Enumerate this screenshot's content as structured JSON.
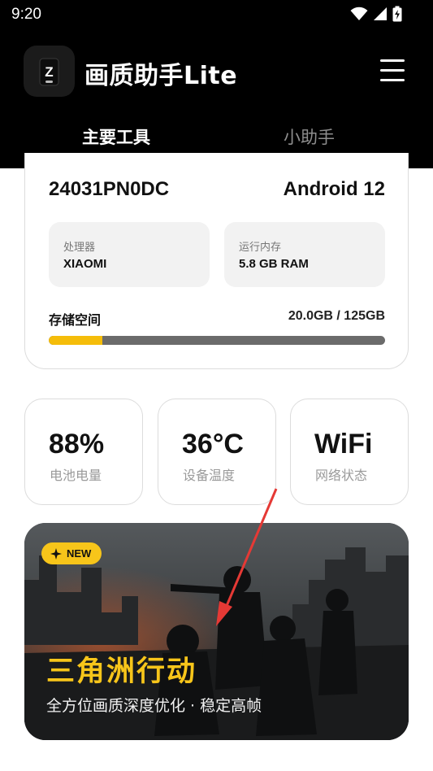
{
  "status_bar": {
    "time": "9:20",
    "icons": [
      "wifi-icon",
      "signal-icon",
      "battery-charging-icon"
    ]
  },
  "app": {
    "title": "画质助手Lite",
    "icon_letter": "Z",
    "menu_icon": "hamburger-menu-icon"
  },
  "tabs": [
    {
      "label": "主要工具",
      "active": true
    },
    {
      "label": "小助手",
      "active": false
    }
  ],
  "device": {
    "model": "24031PN0DC",
    "os": "Android 12",
    "processor": {
      "label": "处理器",
      "value": "XIAOMI"
    },
    "ram": {
      "label": "运行内存",
      "value": "5.8 GB RAM"
    },
    "storage": {
      "label": "存储空间",
      "value": "20.0GB / 125GB",
      "used_fraction": 0.16
    }
  },
  "stats": [
    {
      "value": "88%",
      "label": "电池电量"
    },
    {
      "value": "36°C",
      "label": "设备温度"
    },
    {
      "value": "WiFi",
      "label": "网络状态"
    }
  ],
  "banner": {
    "badge": "NEW",
    "badge_icon": "sparkle-icon",
    "title": "三角洲行动",
    "subtitle": "全方位画质深度优化 · 稳定高帧"
  },
  "colors": {
    "accent": "#f7c51a",
    "topbar": "#000000",
    "track": "#6b6b6b"
  }
}
